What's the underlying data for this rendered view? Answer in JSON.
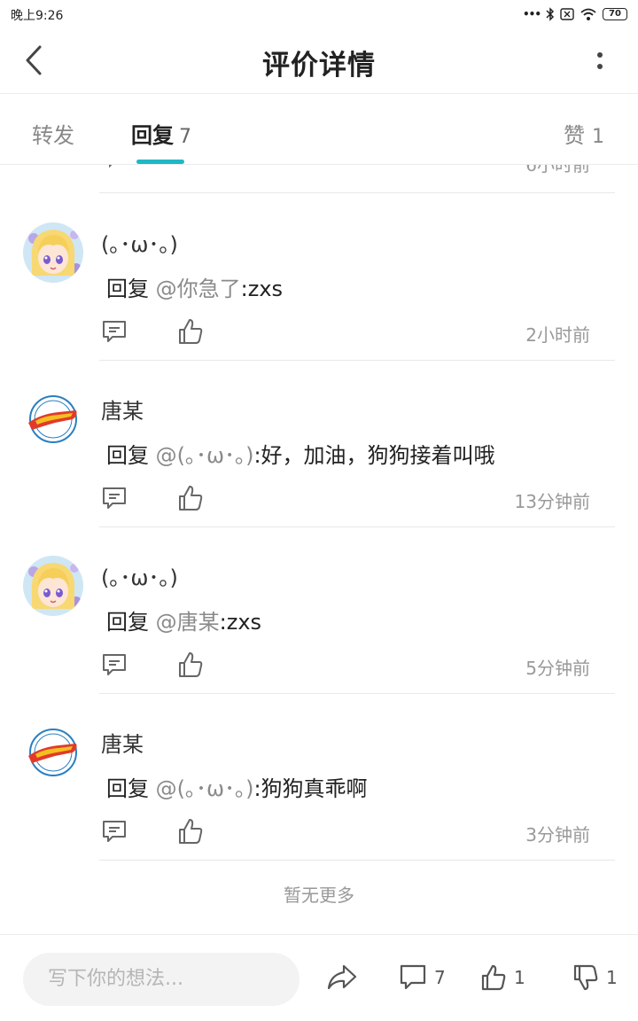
{
  "status_bar": {
    "time": "晚上9:26",
    "icons": [
      "more-dots-icon",
      "bluetooth-icon",
      "sim-icon",
      "wifi-icon"
    ],
    "battery": "70"
  },
  "header": {
    "title": "评价详情",
    "back_icon": "back-arrow-icon",
    "more_icon": "more-vertical-icon"
  },
  "tabs": {
    "forward": "转发",
    "reply": "回复",
    "reply_count": "7",
    "like": "赞",
    "like_count": "1",
    "active_color": "#1fb8c4"
  },
  "partial_item": {
    "time": "6小时前"
  },
  "comments": [
    {
      "name": "(｡･ω･｡)",
      "avatar": "anime-girl-avatar",
      "prefix": "回复 ",
      "mention": "@你急了",
      "text": ":zxs",
      "time": "2小时前"
    },
    {
      "name": "唐某",
      "avatar": "hot-wheels-logo-avatar",
      "prefix": "回复 ",
      "mention": "@(｡･ω･｡)",
      "text": ":好，加油，狗狗接着叫哦",
      "time": "13分钟前"
    },
    {
      "name": "(｡･ω･｡)",
      "avatar": "anime-girl-avatar",
      "prefix": "回复 ",
      "mention": "@唐某",
      "text": ":zxs",
      "time": "5分钟前"
    },
    {
      "name": "唐某",
      "avatar": "hot-wheels-logo-avatar",
      "prefix": "回复 ",
      "mention": "@(｡･ω･｡)",
      "text": ":狗狗真乖啊",
      "time": "3分钟前"
    }
  ],
  "no_more": "暂无更多",
  "bottom_bar": {
    "placeholder": "写下你的想法...",
    "comment_count": "7",
    "like_count": "1",
    "dislike_count": "1"
  }
}
